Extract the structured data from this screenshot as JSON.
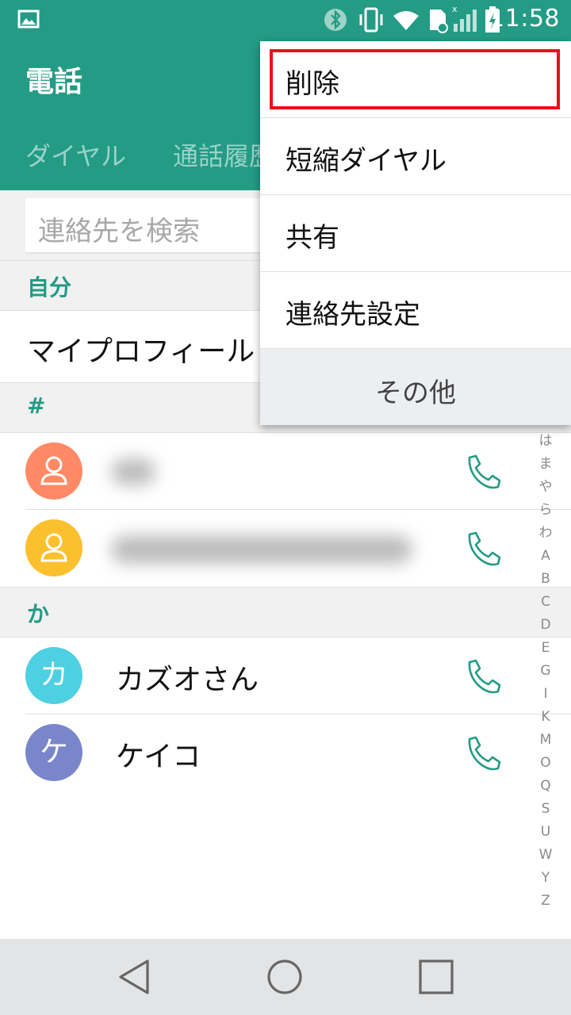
{
  "status_bar": {
    "time": "11:58",
    "icons": [
      "image-icon",
      "bluetooth-icon",
      "vibrate-icon",
      "wifi-icon",
      "sd-card-icon",
      "signal-icon",
      "battery-charging-icon"
    ]
  },
  "app_bar": {
    "title": "電話",
    "tabs": [
      "ダイヤル",
      "通話履歴"
    ]
  },
  "search": {
    "placeholder": "連絡先を検索"
  },
  "sections": {
    "self_header": "自分",
    "profile_label": "マイプロフィール",
    "hash_header": "#",
    "ka_header": "か"
  },
  "contacts": [
    {
      "name": "カズオさん",
      "initial": "カ",
      "color": "#4dd0e1"
    },
    {
      "name": "ケイコ",
      "initial": "ケ",
      "color": "#7986cb"
    }
  ],
  "blurred_contacts": [
    {
      "color": "#ff8a65"
    },
    {
      "color": "#fbc02d"
    }
  ],
  "index_letters": [
    "は",
    "ま",
    "や",
    "ら",
    "わ",
    "A",
    "B",
    "C",
    "D",
    "E",
    "G",
    "I",
    "K",
    "M",
    "O",
    "Q",
    "S",
    "U",
    "W",
    "Y",
    "Z"
  ],
  "menu": {
    "items": [
      "削除",
      "短縮ダイヤル",
      "共有",
      "連絡先設定"
    ],
    "more": "その他",
    "highlight_color": "#e8111a"
  },
  "colors": {
    "accent": "#239b85"
  }
}
